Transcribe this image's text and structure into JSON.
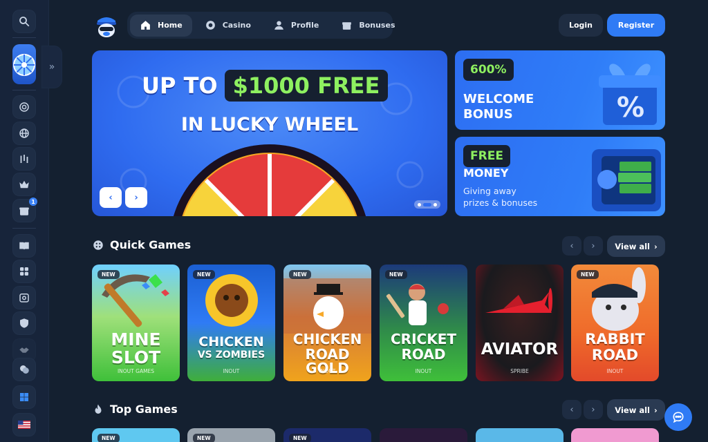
{
  "nav": {
    "items": [
      {
        "label": "Home",
        "icon": "home-icon",
        "active": true
      },
      {
        "label": "Casino",
        "icon": "casino-chip-icon",
        "active": false
      },
      {
        "label": "Profile",
        "icon": "user-icon",
        "active": false
      },
      {
        "label": "Bonuses",
        "icon": "gift-icon",
        "active": false
      }
    ]
  },
  "auth": {
    "login": "Login",
    "register": "Register"
  },
  "sidebar": {
    "notification_count": "1",
    "icons": [
      "search-icon",
      "lucky-wheel-icon",
      "casino-chip-icon",
      "globe-icon",
      "chart-icon",
      "crown-icon",
      "gift-icon",
      "book-icon",
      "games-icon",
      "safe-icon",
      "shield-icon",
      "handshake-icon",
      "support-chat-icon",
      "windows-icon",
      "us-flag-icon"
    ]
  },
  "hero": {
    "prefix": "UP TO",
    "amount": "$1000 FREE",
    "line2": "IN LUCKY WHEEL",
    "prev": "‹",
    "next": "›"
  },
  "promos": [
    {
      "pill": "600%",
      "title_line1": "WELCOME",
      "title_line2": "BONUS"
    },
    {
      "pill": "FREE",
      "title_line1": "MONEY",
      "sub_line1": "Giving away",
      "sub_line2": "prizes & bonuses"
    }
  ],
  "quick_games": {
    "title": "Quick Games",
    "view_all": "View all",
    "games": [
      {
        "badge": "NEW",
        "title_line1": "MINE",
        "title_line2": "SLOT",
        "provider": "INOUT GAMES",
        "bg": "#37b838"
      },
      {
        "badge": "NEW",
        "title_line1": "CHICKEN",
        "title_line2": "VS ZOMBIES",
        "provider": "INOUT",
        "bg": "#1b5fd2"
      },
      {
        "badge": "NEW",
        "title_line1": "CHICKEN",
        "title_line2": "ROAD GOLD",
        "provider": "INOUT",
        "bg": "#f0a31c"
      },
      {
        "badge": "NEW",
        "title_line1": "CRICKET",
        "title_line2": "ROAD",
        "provider": "INOUT",
        "bg": "#2fa83a"
      },
      {
        "badge": "",
        "title_line1": "AVIATOR",
        "title_line2": "",
        "provider": "SPRIBE",
        "bg": "#1a1a1e"
      },
      {
        "badge": "NEW",
        "title_line1": "RABBIT",
        "title_line2": "ROAD",
        "provider": "INOUT",
        "bg": "#ef6a2a"
      }
    ]
  },
  "top_games": {
    "title": "Top Games",
    "view_all": "View all",
    "badges": [
      "NEW",
      "NEW",
      "NEW",
      "",
      "",
      ""
    ]
  }
}
